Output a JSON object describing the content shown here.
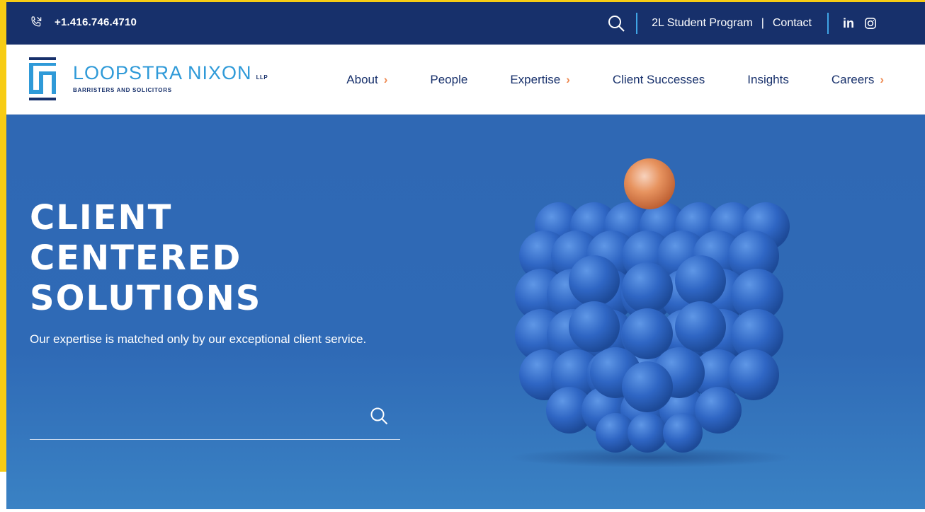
{
  "topbar": {
    "phone_icon": "phone-icon",
    "phone": "+1.416.746.4710",
    "search_icon": "search-icon",
    "links": [
      "2L Student Program",
      "Contact"
    ],
    "separator": "|",
    "social": {
      "linkedin": "in",
      "instagram_icon": "instagram-icon"
    }
  },
  "logo": {
    "name": "LOOPSTRA NIXON",
    "llp": "LLP",
    "subtitle": "BARRISTERS AND SOLICITORS"
  },
  "nav": {
    "items": [
      {
        "label": "About",
        "has_chevron": true
      },
      {
        "label": "People",
        "has_chevron": false
      },
      {
        "label": "Expertise",
        "has_chevron": true
      },
      {
        "label": "Client Successes",
        "has_chevron": false
      },
      {
        "label": "Insights",
        "has_chevron": false
      },
      {
        "label": "Careers",
        "has_chevron": true
      }
    ],
    "chevron": "›"
  },
  "hero": {
    "title_lines": [
      "CLIENT",
      "CENTERED",
      "SOLUTIONS"
    ],
    "subtitle": "Our expertise is matched only by our exceptional client service.",
    "search_placeholder": "",
    "search_icon": "search-icon"
  },
  "colors": {
    "brand_navy": "#17306b",
    "brand_blue": "#2f9ad8",
    "accent_orange": "#ee8a52",
    "hero_blue": "#2f68b4",
    "frame_yellow": "#f7cc14"
  }
}
